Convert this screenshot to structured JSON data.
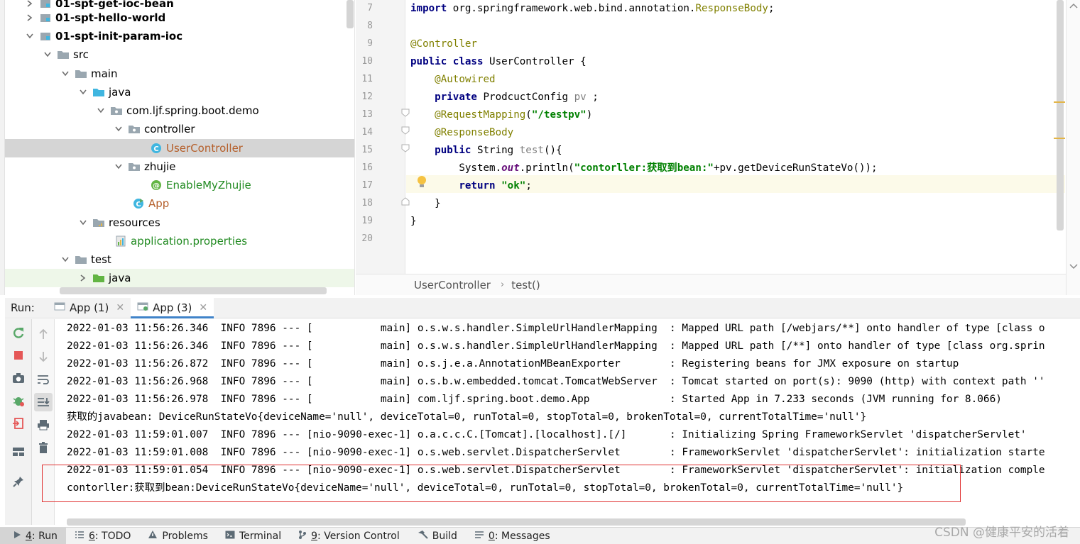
{
  "project_tree": {
    "items": [
      {
        "label": "01-spt-get-ioc-bean",
        "type": "module",
        "bold": true
      },
      {
        "label": "01-spt-hello-world",
        "type": "module",
        "bold": true
      },
      {
        "label": "01-spt-init-param-ioc",
        "type": "module",
        "bold": true
      },
      {
        "label": "src",
        "type": "folder"
      },
      {
        "label": "main",
        "type": "folder"
      },
      {
        "label": "java",
        "type": "source-folder"
      },
      {
        "label": "com.ljf.spring.boot.demo",
        "type": "package"
      },
      {
        "label": "controller",
        "type": "package"
      },
      {
        "label": "UserController",
        "type": "class",
        "selected": true
      },
      {
        "label": "zhujie",
        "type": "package"
      },
      {
        "label": "EnableMyZhujie",
        "type": "annotation"
      },
      {
        "label": "App",
        "type": "class-run"
      },
      {
        "label": "resources",
        "type": "resources-folder"
      },
      {
        "label": "application.properties",
        "type": "properties"
      },
      {
        "label": "test",
        "type": "folder"
      },
      {
        "label": "java",
        "type": "test-source-folder"
      }
    ]
  },
  "editor": {
    "line_numbers": [
      "7",
      "8",
      "9",
      "10",
      "11",
      "12",
      "13",
      "14",
      "15",
      "16",
      "17",
      "18",
      "19",
      "20"
    ],
    "lines": [
      {
        "kw": "import",
        "text": " org.springframework.web.bind.annotation.",
        "ann": "ResponseBody",
        "tail": ";"
      },
      {},
      {
        "ann": "@Controller"
      },
      {
        "kw": "public class",
        "text": " UserController {"
      },
      {
        "indent": "    ",
        "ann": "@Autowired"
      },
      {
        "indent": "    ",
        "kw": "private",
        "text": " ProdcuctConfig ",
        "var": "pv",
        "tail": " ;"
      },
      {
        "indent": "    ",
        "ann": "@RequestMapping",
        "text": "(",
        "str": "\"/testpv\"",
        "tail": ")"
      },
      {
        "indent": "    ",
        "ann": "@ResponseBody"
      },
      {
        "indent": "    ",
        "kw": "public",
        "text": " String ",
        "var": "test",
        "tail": "(){"
      },
      {
        "indent": "        ",
        "pre": "System.",
        "fld": "out",
        "mid": ".println(",
        "str": "\"contorller:获取到bean:\"",
        "tail": "+pv.getDeviceRunStateVo());"
      },
      {
        "indent": "        ",
        "kw": "return",
        "text": " ",
        "str": "\"ok\"",
        "tail": ";"
      },
      {
        "indent": "    ",
        "text": "}"
      },
      {
        "text": "}"
      },
      {}
    ],
    "breadcrumb": [
      "UserController",
      "test()"
    ]
  },
  "run_panel": {
    "label": "Run:",
    "tabs": [
      {
        "label": "App (1)",
        "active": false
      },
      {
        "label": "App (3)",
        "active": true
      }
    ],
    "console_lines": [
      "2022-01-03 11:56:26.346  INFO 7896 --- [           main] o.s.w.s.handler.SimpleUrlHandlerMapping  : Mapped URL path [/webjars/**] onto handler of type [class o",
      "2022-01-03 11:56:26.346  INFO 7896 --- [           main] o.s.w.s.handler.SimpleUrlHandlerMapping  : Mapped URL path [/**] onto handler of type [class org.sprin",
      "2022-01-03 11:56:26.872  INFO 7896 --- [           main] o.s.j.e.a.AnnotationMBeanExporter        : Registering beans for JMX exposure on startup",
      "2022-01-03 11:56:26.968  INFO 7896 --- [           main] o.s.b.w.embedded.tomcat.TomcatWebServer  : Tomcat started on port(s): 9090 (http) with context path ''",
      "2022-01-03 11:56:26.978  INFO 7896 --- [           main] com.ljf.spring.boot.demo.App             : Started App in 7.233 seconds (JVM running for 8.066)",
      "获取的javabean: DeviceRunStateVo{deviceName='null', deviceTotal=0, runTotal=0, stopTotal=0, brokenTotal=0, currentTotalTime='null'}",
      "2022-01-03 11:59:01.007  INFO 7896 --- [nio-9090-exec-1] o.a.c.c.C.[Tomcat].[localhost].[/]       : Initializing Spring FrameworkServlet 'dispatcherServlet'",
      "2022-01-03 11:59:01.008  INFO 7896 --- [nio-9090-exec-1] o.s.web.servlet.DispatcherServlet        : FrameworkServlet 'dispatcherServlet': initialization starte",
      "2022-01-03 11:59:01.054  INFO 7896 --- [nio-9090-exec-1] o.s.web.servlet.DispatcherServlet        : FrameworkServlet 'dispatcherServlet': initialization comple",
      "contorller:获取到bean:DeviceRunStateVo{deviceName='null', deviceTotal=0, runTotal=0, stopTotal=0, brokenTotal=0, currentTotalTime='null'}"
    ]
  },
  "bottom_bar": {
    "items": [
      {
        "key": "4",
        "label": ": Run",
        "icon": "run-icon",
        "active": true
      },
      {
        "key": "6",
        "label": ": TODO",
        "icon": "todo-icon"
      },
      {
        "key": "",
        "label": "Problems",
        "icon": "warning-icon"
      },
      {
        "key": "",
        "label": "Terminal",
        "icon": "terminal-icon"
      },
      {
        "key": "9",
        "label": ": Version Control",
        "icon": "vcs-icon"
      },
      {
        "key": "",
        "label": "Build",
        "icon": "hammer-icon"
      },
      {
        "key": "0",
        "label": ": Messages",
        "icon": "messages-icon"
      }
    ]
  },
  "watermark": "CSDN @健康平安的活着",
  "colors": {
    "keyword": "#000080",
    "annotation": "#808000",
    "string": "#008000",
    "field": "#660e7a",
    "selection": "#d5d5d5",
    "highlight_box": "#e03030",
    "current_line": "#fcfae9"
  }
}
